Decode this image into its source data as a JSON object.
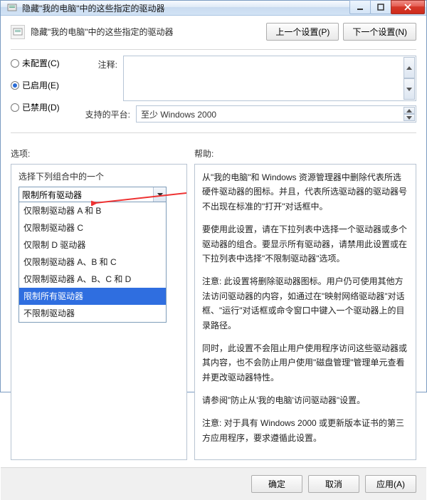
{
  "titlebar": {
    "title": "隐藏\"我的电脑\"中的这些指定的驱动器"
  },
  "header": {
    "text": "隐藏\"我的电脑\"中的这些指定的驱动器",
    "prev_btn": "上一个设置(P)",
    "next_btn": "下一个设置(N)"
  },
  "radios": {
    "none": "未配置(C)",
    "enabled": "已启用(E)",
    "disabled": "已禁用(D)",
    "selected": "enabled"
  },
  "fields": {
    "comment_label": "注释:",
    "platform_label": "支持的平台:",
    "platform_value": "至少 Windows 2000"
  },
  "labels": {
    "options": "选项:",
    "help": "帮助:"
  },
  "left_panel": {
    "caption": "选择下列组合中的一个",
    "combo_value": "限制所有驱动器",
    "options": [
      "仅限制驱动器 A 和 B",
      "仅限制驱动器 C",
      "仅限制 D 驱动器",
      "仅限制驱动器 A、B 和 C",
      "仅限制驱动器 A、B、C 和 D",
      "限制所有驱动器",
      "不限制驱动器"
    ]
  },
  "help": {
    "p1": "从\"我的电脑\"和 Windows 资源管理器中删除代表所选硬件驱动器的图标。并且，代表所选驱动器的驱动器号不出现在标准的\"打开\"对话框中。",
    "p2": "要使用此设置，请在下拉列表中选择一个驱动器或多个驱动器的组合。要显示所有驱动器，请禁用此设置或在下拉列表中选择\"不限制驱动器\"选项。",
    "p3": "注意: 此设置将删除驱动器图标。用户仍可使用其他方法访问驱动器的内容，如通过在\"映射网络驱动器\"对话框、\"运行\"对话框或命令窗口中键入一个驱动器上的目录路径。",
    "p4": "同时，此设置不会阻止用户使用程序访问这些驱动器或其内容，也不会防止用户使用\"磁盘管理\"管理单元查看并更改驱动器特性。",
    "p5": "请参阅\"防止从'我的电脑'访问驱动器\"设置。",
    "p6": "注意: 对于具有 Windows 2000 或更新版本证书的第三方应用程序，要求遵循此设置。"
  },
  "footer": {
    "ok": "确定",
    "cancel": "取消",
    "apply": "应用(A)"
  }
}
